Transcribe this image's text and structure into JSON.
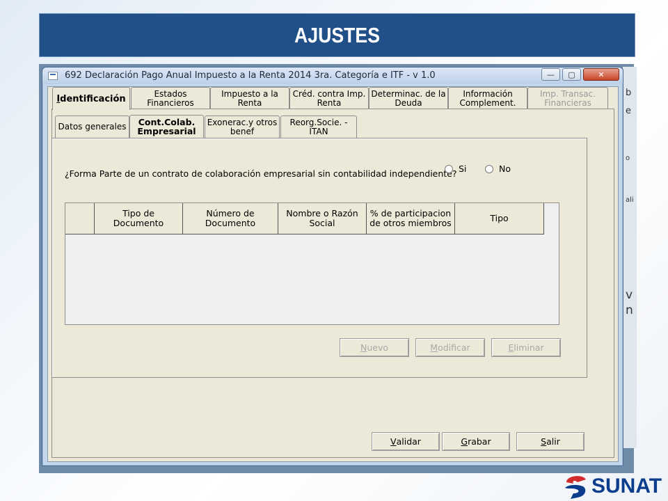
{
  "slide": {
    "title": "AJUSTES"
  },
  "right_strip": {
    "fragments": [
      "b",
      "e",
      "o",
      "ali",
      "v",
      "n"
    ]
  },
  "window": {
    "title": "692 Declaración Pago Anual Impuesto a la Renta 2014 3ra. Categoría e ITF - v 1.0",
    "min_glyph": "—",
    "max_glyph": "▢",
    "close_glyph": "✕"
  },
  "main_tabs": [
    {
      "line1": "Identificación",
      "line2": "",
      "state": "active"
    },
    {
      "line1": "Estados",
      "line2": "Financieros",
      "state": "normal"
    },
    {
      "line1": "Impuesto a  la",
      "line2": "Renta",
      "state": "normal"
    },
    {
      "line1": "Créd. contra Imp.",
      "line2": "Renta",
      "state": "normal"
    },
    {
      "line1": "Determinac. de la",
      "line2": "Deuda",
      "state": "normal"
    },
    {
      "line1": "Información",
      "line2": "Complement.",
      "state": "normal"
    },
    {
      "line1": "Imp. Transac.",
      "line2": "Financieras",
      "state": "disabled"
    }
  ],
  "sub_tabs": [
    {
      "line1": "Datos generales",
      "line2": "",
      "state": "normal"
    },
    {
      "line1": "Cont.Colab.",
      "line2": "Empresarial",
      "state": "active"
    },
    {
      "line1": "Exonerac.y otros",
      "line2": "benef",
      "state": "normal"
    },
    {
      "line1": "Reorg.Socie. -",
      "line2": "ITAN",
      "state": "normal"
    }
  ],
  "form": {
    "question": "¿Forma Parte de un contrato de colaboración empresarial sin contabilidad independiente?",
    "options": [
      {
        "label": "Si",
        "selected": false
      },
      {
        "label": "No",
        "selected": false
      }
    ]
  },
  "grid": {
    "columns": [
      {
        "line1": "",
        "line2": ""
      },
      {
        "line1": "Tipo de Documento",
        "line2": ""
      },
      {
        "line1": "Número de",
        "line2": "Documento"
      },
      {
        "line1": "Nombre o Razón",
        "line2": "Social"
      },
      {
        "line1": "%  de participacion",
        "line2": "de otros miembros"
      },
      {
        "line1": "Tipo",
        "line2": ""
      }
    ],
    "rows": []
  },
  "grid_buttons": {
    "new": {
      "accel": "N",
      "rest": "uevo",
      "enabled": false
    },
    "modify": {
      "accel": "M",
      "rest": "odificar",
      "enabled": false
    },
    "delete": {
      "accel": "E",
      "rest": "liminar",
      "enabled": false
    }
  },
  "footer_buttons": {
    "validate": {
      "accel": "V",
      "rest": "alidar"
    },
    "save": {
      "accel": "G",
      "rest": "rabar"
    },
    "exit": {
      "accel": "S",
      "rest": "alir"
    }
  },
  "logo": {
    "text": "SUNAT",
    "colors": {
      "red": "#d22b2b",
      "blue": "#0b3d8c"
    }
  }
}
